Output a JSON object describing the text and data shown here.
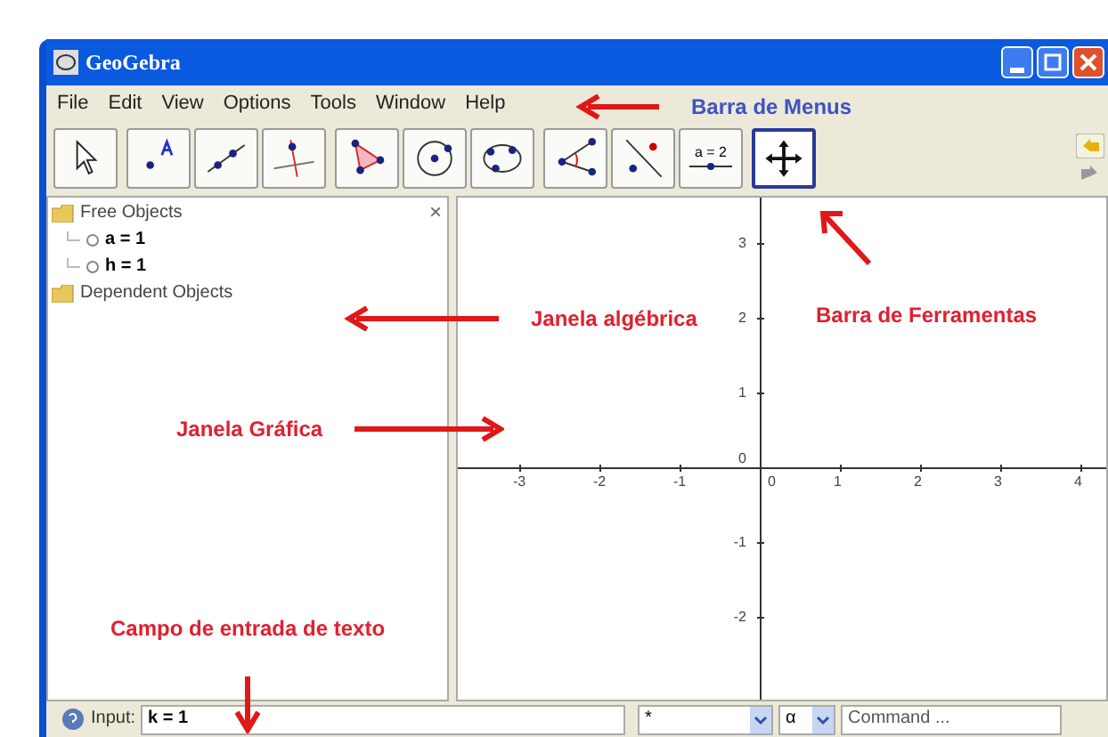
{
  "window": {
    "title": "GeoGebra"
  },
  "menu": [
    "File",
    "Edit",
    "View",
    "Options",
    "Tools",
    "Window",
    "Help"
  ],
  "tool_groups": [
    [
      {
        "kind": "pointer",
        "selected": false
      }
    ],
    [
      {
        "kind": "point",
        "selected": false
      },
      {
        "kind": "line",
        "selected": false
      },
      {
        "kind": "perpendicular",
        "selected": false
      }
    ],
    [
      {
        "kind": "polygon",
        "selected": false
      },
      {
        "kind": "circle",
        "selected": false
      },
      {
        "kind": "conic",
        "selected": false
      }
    ],
    [
      {
        "kind": "angle",
        "selected": false
      },
      {
        "kind": "reflect",
        "selected": false
      },
      {
        "kind": "slider",
        "label": "a = 2",
        "selected": false
      }
    ],
    [
      {
        "kind": "move",
        "selected": true
      }
    ]
  ],
  "algebra": {
    "close": "×",
    "folders": [
      {
        "name": "Free Objects",
        "children": [
          {
            "text": "a = 1",
            "visible": false
          },
          {
            "text": "h = 1",
            "visible": false
          }
        ]
      },
      {
        "name": "Dependent Objects"
      }
    ]
  },
  "graphics": {
    "x_labels": [
      "-3",
      "-2",
      "-1",
      "0",
      "1",
      "2",
      "3",
      "4"
    ],
    "y_labels": [
      "3",
      "2",
      "1",
      "0",
      "-1",
      "-2"
    ]
  },
  "input_bar": {
    "label": "Input:",
    "value": "k = 1",
    "symbol": "*",
    "greek": "α",
    "command": "Command ..."
  },
  "annotations": [
    {
      "text": "Barra de Menus",
      "color": "#3f51c8"
    },
    {
      "text": "Janela algébrica",
      "color": "#e02030"
    },
    {
      "text": "Barra de Ferramentas",
      "color": "#e02030"
    },
    {
      "text": "Janela Gráfica",
      "color": "#e02030"
    },
    {
      "text": "Campo de entrada de texto",
      "color": "#e02030"
    }
  ]
}
